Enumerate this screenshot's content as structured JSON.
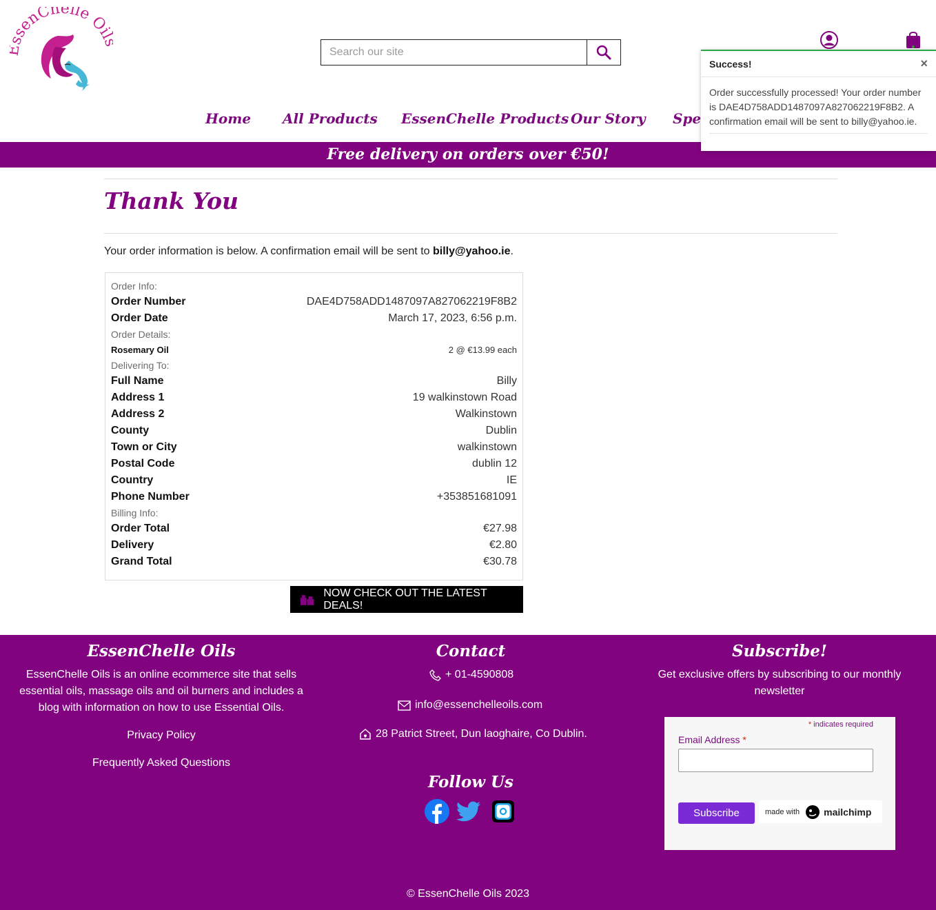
{
  "header": {
    "logo_text": "EssenChelle Oils",
    "search_placeholder": "Search our site"
  },
  "nav": {
    "items": [
      "Home",
      "All Products",
      "EssenChelle Products",
      "Our Story",
      "Spec"
    ]
  },
  "banner": {
    "text": "Free delivery on orders over €50!"
  },
  "toast": {
    "title": "Success!",
    "close": "×",
    "message": "Order successfully processed! Your order number is DAE4D758ADD1487097A827062219F8B2. A confirmation email will be sent to billy@yahoo.ie."
  },
  "main": {
    "title": "Thank You",
    "intro_prefix": "Your order information is below. A confirmation email will be sent to ",
    "intro_email": "billy@yahoo.ie",
    "intro_suffix": "."
  },
  "order": {
    "order_info_label": "Order Info:",
    "order_number_label": "Order Number",
    "order_number": "DAE4D758ADD1487097A827062219F8B2",
    "order_date_label": "Order Date",
    "order_date": "March 17, 2023, 6:56 p.m.",
    "order_details_label": "Order Details:",
    "item_name": "Rosemary Oil",
    "item_qty": "2 @ €13.99 each",
    "delivering_label": "Delivering To:",
    "full_name_label": "Full Name",
    "full_name": "Billy",
    "address1_label": "Address 1",
    "address1": "19 walkinstown Road",
    "address2_label": "Address 2",
    "address2": "Walkinstown",
    "county_label": "County",
    "county": "Dublin",
    "town_label": "Town or City",
    "town": "walkinstown",
    "postal_label": "Postal Code",
    "postal": "dublin 12",
    "country_label": "Country",
    "country": "IE",
    "phone_label": "Phone Number",
    "phone": "+353851681091",
    "billing_label": "Billing Info:",
    "order_total_label": "Order Total",
    "order_total": "€27.98",
    "delivery_label": "Delivery",
    "delivery": "€2.80",
    "grand_total_label": "Grand Total",
    "grand_total": "€30.78"
  },
  "deals_button": "NOW CHECK OUT THE LATEST DEALS!",
  "footer": {
    "about_title": "EssenChelle Oils",
    "about_text": "EssenChelle Oils is an online ecommerce site that sells essential oils, massage oils and oil burners and includes a blog with information on how to use Essential Oils.",
    "privacy": "Privacy Policy",
    "faq": "Frequently Asked Questions",
    "contact_title": "Contact",
    "phone": "+ 01-4590808",
    "email": "info@essenchelleoils.com",
    "address": "28 Patrict Street, Dun laoghaire, Co Dublin.",
    "follow_title": "Follow Us",
    "subscribe_title": "Subscribe!",
    "subscribe_text": "Get exclusive offers by subscribing to our monthly newsletter",
    "required_note": "indicates required",
    "email_label": "Email Address",
    "subscribe_button": "Subscribe",
    "made_with": "made with",
    "mailchimp": "mailchimp",
    "copyright": "© EssenChelle Oils 2023"
  },
  "colors": {
    "brand_purple": "#82037f",
    "success_green": "#28a745",
    "subscribe_purple": "#7b2bd6"
  },
  "icons": [
    "search-icon",
    "account-icon",
    "shopping-bag-icon",
    "close-icon",
    "gifts-icon",
    "phone-icon",
    "envelope-icon",
    "home-icon",
    "facebook-icon",
    "twitter-icon",
    "instagram-icon"
  ]
}
